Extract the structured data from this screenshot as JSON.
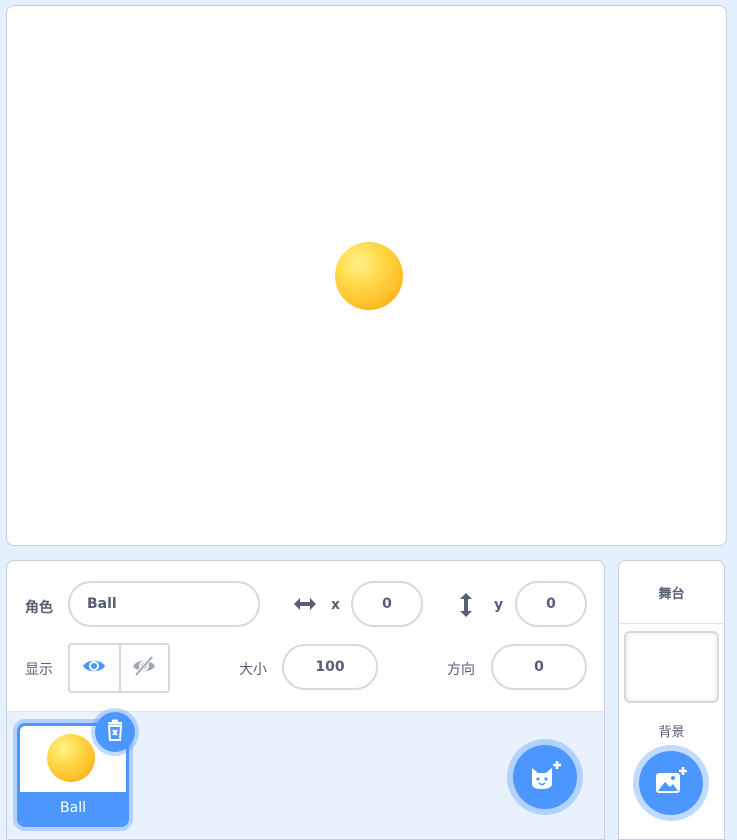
{
  "sprite_info": {
    "sprite_label": "角色",
    "sprite_name": "Ball",
    "x_label": "x",
    "x_value": "0",
    "y_label": "y",
    "y_value": "0",
    "show_label": "显示",
    "size_label": "大小",
    "size_value": "100",
    "direction_label": "方向",
    "direction_value": "0"
  },
  "sprites": [
    {
      "name": "Ball",
      "selected": true
    }
  ],
  "stage_panel": {
    "title": "舞台",
    "backdrop_label": "背景"
  },
  "colors": {
    "accent": "#4c97ff",
    "text": "#575e75",
    "panel_bg": "#e5f0ff"
  },
  "icons": {
    "x_icon": "horizontal-arrows-icon",
    "y_icon": "vertical-arrows-icon",
    "show": "eye-icon",
    "hide": "eye-slash-icon",
    "delete": "trash-icon",
    "add_sprite": "cat-plus-icon",
    "add_backdrop": "image-plus-icon"
  }
}
